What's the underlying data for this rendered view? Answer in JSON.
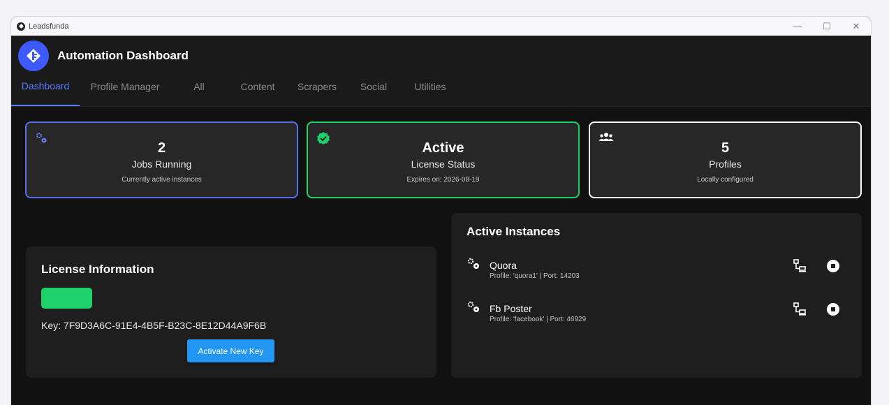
{
  "window": {
    "title": "Leadsfunda",
    "controls": [
      "—",
      "☐",
      "✕"
    ]
  },
  "header": {
    "title": "Automation Dashboard",
    "logo_icon": "logo-icon"
  },
  "tabs": [
    {
      "label": "Dashboard",
      "active": true
    },
    {
      "label": "Profile Manager"
    },
    {
      "label": "All"
    },
    {
      "label": "Content"
    },
    {
      "label": "Scrapers"
    },
    {
      "label": "Social"
    },
    {
      "label": "Utilities"
    }
  ],
  "stats": [
    {
      "value": "2",
      "label": "Jobs Running",
      "sub": "Currently active instances",
      "icon": "gears-icon",
      "border": "#5b6ee8"
    },
    {
      "value": "Active",
      "label": "License Status",
      "sub": "Expires on: 2026-08-19",
      "icon": "verified-badge-icon",
      "border": "#1fd16a"
    },
    {
      "value": "5",
      "label": "Profiles",
      "sub": "Locally configured",
      "icon": "users-icon",
      "border": "#ffffff"
    }
  ],
  "license": {
    "title": "License Information",
    "key": "Key: 7F9D3A6C-91E4-4B5F-B23C-8E12D44A9F6B",
    "activate_label": "Activate New Key",
    "badge_color": "#1fd16a"
  },
  "instances": {
    "title": "Active Instances",
    "items": [
      {
        "name": "Quora",
        "meta": "Profile: 'quora1' | Port: 14203"
      },
      {
        "name": "Fb Poster",
        "meta": "Profile: 'facebook' | Port: 46929"
      }
    ]
  },
  "colors": {
    "accent": "#5b7cfa",
    "success": "#1fd16a",
    "button": "#2196f3"
  }
}
